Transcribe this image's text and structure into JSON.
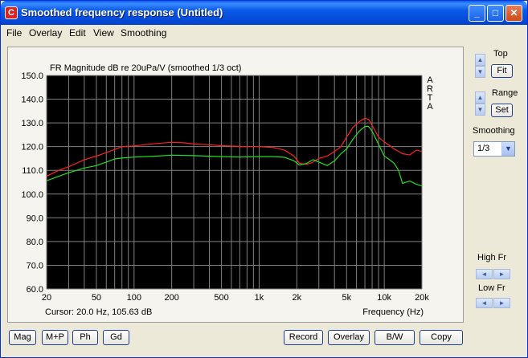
{
  "window": {
    "title": "Smoothed frequency response (Untitled)",
    "app_icon_glyph": "C",
    "minimize_glyph": "_",
    "maximize_glyph": "□",
    "close_glyph": "✕"
  },
  "menu": [
    "File",
    "Overlay",
    "Edit",
    "View",
    "Smoothing"
  ],
  "graph": {
    "header": "FR Magnitude dB re 20uPa/V (smoothed 1/3 oct)",
    "brand": [
      "A",
      "R",
      "T",
      "A"
    ],
    "cursor_text": "Cursor: 20.0 Hz, 105.63 dB",
    "x_title": "Frequency (Hz)",
    "x_tick_labels": [
      {
        "f": 20,
        "label": "20"
      },
      {
        "f": 50,
        "label": "50"
      },
      {
        "f": 100,
        "label": "100"
      },
      {
        "f": 200,
        "label": "200"
      },
      {
        "f": 500,
        "label": "500"
      },
      {
        "f": 1000,
        "label": "1k"
      },
      {
        "f": 2000,
        "label": "2k"
      },
      {
        "f": 5000,
        "label": "5k"
      },
      {
        "f": 10000,
        "label": "10k"
      },
      {
        "f": 20000,
        "label": "20k"
      }
    ],
    "y_tick_labels": [
      "150.0",
      "140.0",
      "130.0",
      "120.0",
      "110.0",
      "100.0",
      "90.0",
      "80.0",
      "70.0",
      "60.0"
    ],
    "colors": {
      "plot_bg": "#000000",
      "grid": "#808080",
      "red": "#ff2020",
      "green": "#20e020",
      "text": "#000000"
    }
  },
  "chart_data": {
    "type": "line",
    "x_scale": "log",
    "xlim": [
      20,
      20000
    ],
    "ylim": [
      60,
      150
    ],
    "title": "FR Magnitude dB re 20uPa/V (smoothed 1/3 oct)",
    "xlabel": "Frequency (Hz)",
    "ylabel": "",
    "grid": true,
    "series": [
      {
        "color": "#ff2020",
        "x": [
          20,
          25,
          30,
          40,
          50,
          60,
          70,
          80,
          100,
          120,
          150,
          200,
          250,
          300,
          400,
          500,
          700,
          1000,
          1300,
          1600,
          1900,
          2100,
          2400,
          2700,
          3000,
          3500,
          4000,
          4500,
          5000,
          5600,
          6300,
          7000,
          7500,
          8000,
          9000,
          10000,
          11000,
          12000,
          13000,
          14000,
          16000,
          18000,
          20000
        ],
        "values": [
          107.5,
          110,
          111.5,
          114.5,
          116,
          117.5,
          118.8,
          120,
          120.3,
          120.8,
          121.3,
          121.8,
          121.6,
          121.1,
          120.8,
          120.4,
          120.1,
          120,
          119.6,
          118.5,
          116,
          113,
          112.5,
          113.5,
          115,
          116,
          118,
          120,
          124,
          128,
          130.5,
          132,
          131.5,
          129,
          124,
          122,
          120.5,
          119,
          118,
          117,
          116.5,
          118.5,
          118
        ]
      },
      {
        "color": "#20e020",
        "x": [
          20,
          25,
          30,
          40,
          50,
          60,
          70,
          80,
          100,
          150,
          200,
          300,
          500,
          700,
          1000,
          1300,
          1600,
          1900,
          2100,
          2400,
          2700,
          3000,
          3500,
          4000,
          4500,
          5000,
          5600,
          6300,
          7000,
          7500,
          8000,
          9000,
          10000,
          11000,
          12000,
          13000,
          14000,
          16000,
          18000,
          20000
        ],
        "values": [
          105.6,
          107.5,
          109,
          111,
          112,
          113.5,
          114.8,
          115.2,
          115.6,
          116,
          116.4,
          116.2,
          115.8,
          115.6,
          115.8,
          115.8,
          115.5,
          114,
          112.2,
          113,
          114.5,
          113.5,
          112,
          114,
          117,
          119,
          123,
          126.5,
          128.5,
          128.5,
          126.5,
          121,
          116,
          114.5,
          113,
          110,
          104.5,
          105.5,
          104.2,
          103.4
        ]
      }
    ]
  },
  "side": {
    "top_label": "Top",
    "fit_button": "Fit",
    "range_label": "Range",
    "set_button": "Set",
    "smoothing_label": "Smoothing",
    "smoothing_value": "1/3",
    "high_fr_label": "High Fr",
    "low_fr_label": "Low Fr",
    "up_glyph": "▲",
    "down_glyph": "▼",
    "left_glyph": "◄",
    "right_glyph": "►",
    "dropdown_glyph": "▼"
  },
  "bottom": {
    "mag": "Mag",
    "mp": "M+P",
    "ph": "Ph",
    "gd": "Gd",
    "record": "Record",
    "overlay": "Overlay",
    "bw": "B/W",
    "copy": "Copy"
  }
}
